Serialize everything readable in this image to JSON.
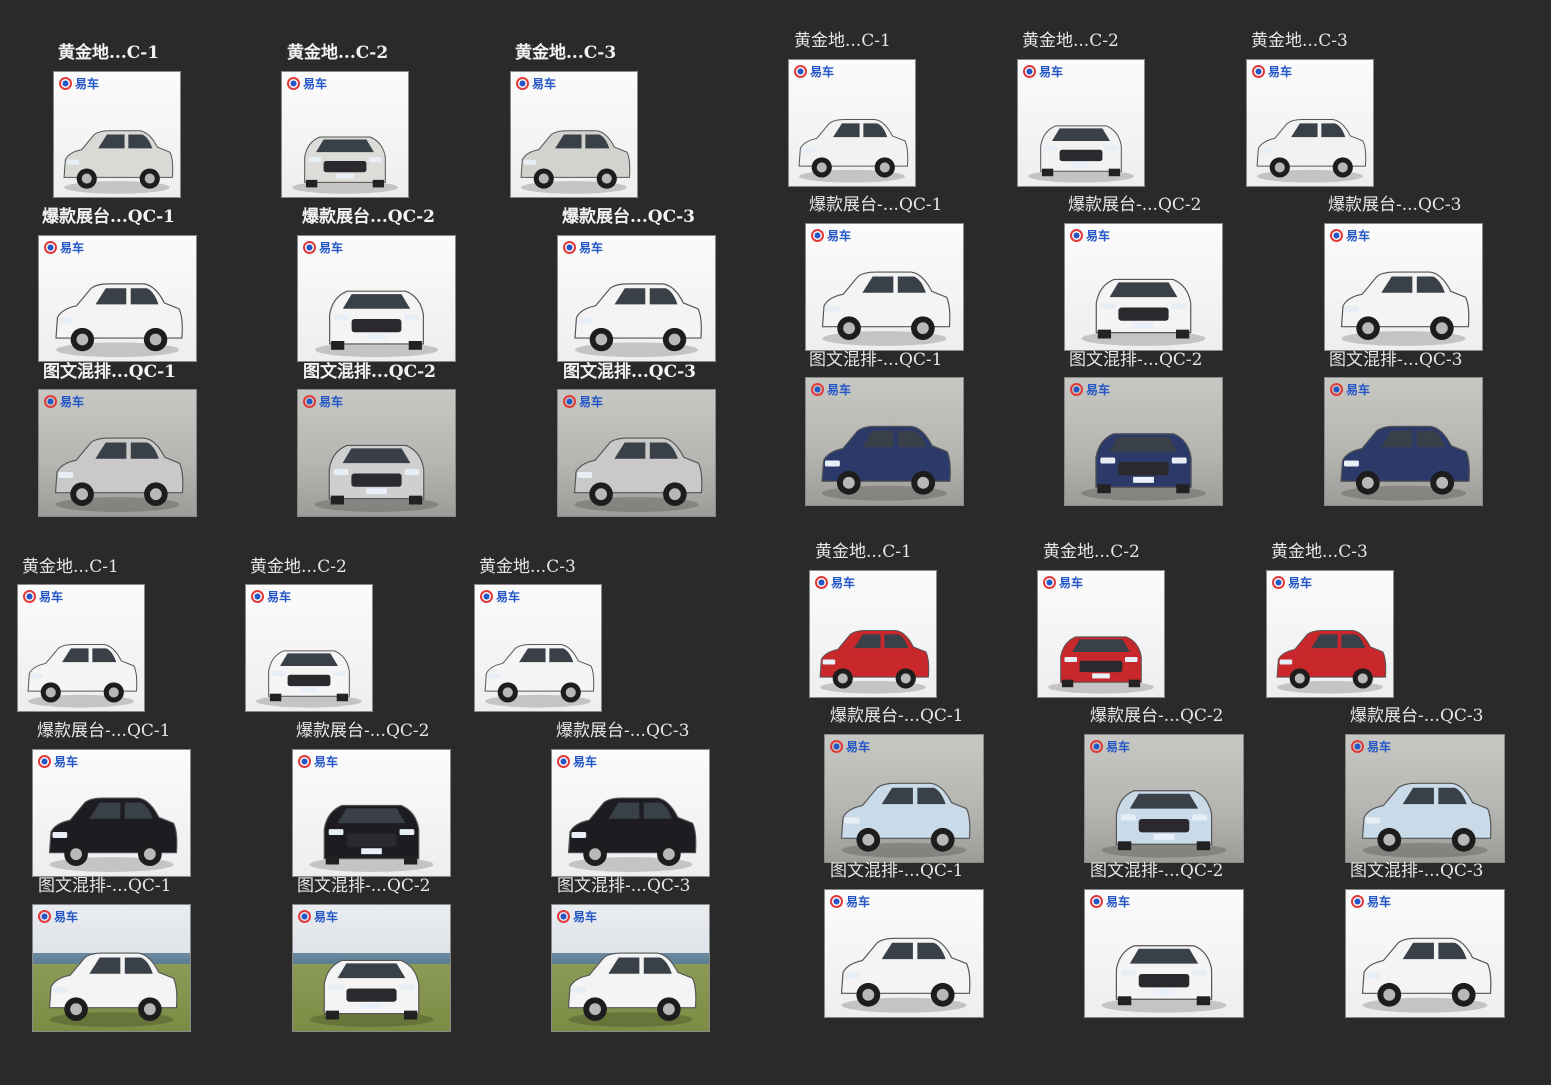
{
  "brand": "易车",
  "colors": {
    "page_bg": "#2a2a2a",
    "thumb_border": "#8a8a8a",
    "logo_blue": "#2457c5",
    "logo_red": "#e03a3a"
  },
  "groups": [
    {
      "id": "wuling-mpv",
      "rows": [
        [
          "黄金地...C-1",
          "黄金地...C-2",
          "黄金地...C-3"
        ],
        [
          "爆款展台...QC-1",
          "爆款展台...QC-2",
          "爆款展台...QC-3"
        ],
        [
          "图文混排...QC-1",
          "图文混排...QC-2",
          "图文混排...QC-3"
        ]
      ],
      "car_colors": [
        [
          "#d9d9d6",
          "#dcdcd9",
          "#d2d2cf"
        ],
        [
          "#f4f4f4",
          "#f4f4f4",
          "#f4f4f4"
        ],
        [
          "#c9c9c9",
          "#cfcfcf",
          "#c9c9c9"
        ]
      ]
    },
    {
      "id": "white-suv-blue-suv",
      "rows": [
        [
          "黄金地...C-1",
          "黄金地...C-2",
          "黄金地...C-3"
        ],
        [
          "爆款展台-...QC-1",
          "爆款展台-...QC-2",
          "爆款展台-...QC-3"
        ],
        [
          "图文混排-...QC-1",
          "图文混排-...QC-2",
          "图文混排-...QC-3"
        ]
      ],
      "car_colors": [
        [
          "#f2f2f2",
          "#f2f2f2",
          "#f2f2f2"
        ],
        [
          "#f4f4f4",
          "#f4f4f4",
          "#f4f4f4"
        ],
        [
          "#2c3a6a",
          "#2c3a6a",
          "#2c3a6a"
        ]
      ]
    },
    {
      "id": "honda-suv",
      "rows": [
        [
          "黄金地...C-1",
          "黄金地...C-2",
          "黄金地...C-3"
        ],
        [
          "爆款展台-...QC-1",
          "爆款展台-...QC-2",
          "爆款展台-...QC-3"
        ],
        [
          "图文混排-...QC-1",
          "图文混排-...QC-2",
          "图文混排-...QC-3"
        ]
      ],
      "car_colors": [
        [
          "#f5f5f5",
          "#f5f5f5",
          "#f5f5f5"
        ],
        [
          "#1c1c22",
          "#1c1c22",
          "#1c1c22"
        ],
        [
          "#f4f4f4",
          "#f4f4f4",
          "#f4f4f4"
        ]
      ]
    },
    {
      "id": "red-offroad-suv",
      "rows": [
        [
          "黄金地...C-1",
          "黄金地...C-2",
          "黄金地...C-3"
        ],
        [
          "爆款展台-...QC-1",
          "爆款展台-...QC-2",
          "爆款展台-...QC-3"
        ],
        [
          "图文混排-...QC-1",
          "图文混排-...QC-2",
          "图文混排-...QC-3"
        ]
      ],
      "car_colors": [
        [
          "#c8282c",
          "#c8282c",
          "#c8282c"
        ],
        [
          "#c9dbe8",
          "#c9dbe8",
          "#c9dbe8"
        ],
        [
          "#f4f4f4",
          "#f4f4f4",
          "#f4f4f4"
        ]
      ]
    }
  ]
}
